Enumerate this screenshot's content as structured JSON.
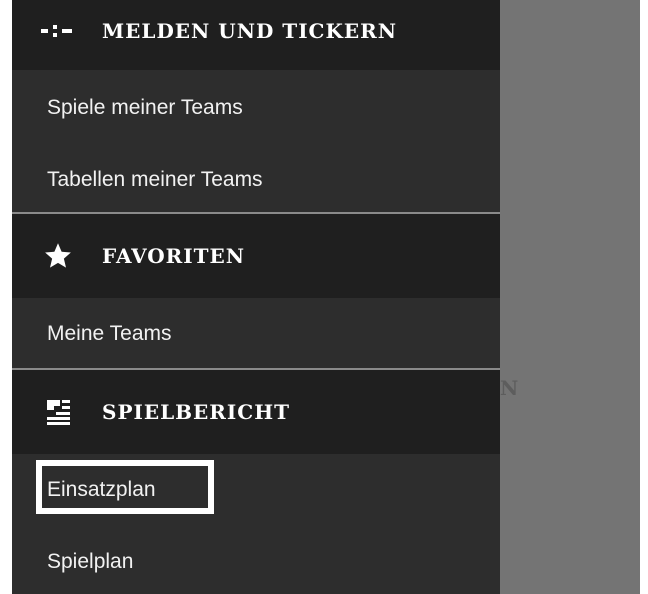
{
  "sections": {
    "melden": {
      "title": "MELDEN UND TICKERN",
      "icon": "ticker-icon",
      "items": [
        {
          "label": "Spiele meiner Teams"
        },
        {
          "label": "Tabellen meiner Teams"
        }
      ]
    },
    "favoriten": {
      "title": "FAVORITEN",
      "icon": "star-icon",
      "items": [
        {
          "label": "Meine Teams"
        }
      ]
    },
    "spielbericht": {
      "title": "SPIELBERICHT",
      "icon": "report-icon",
      "items": [
        {
          "label": "Einsatzplan"
        },
        {
          "label": "Spielplan"
        }
      ]
    }
  },
  "background": {
    "partial_text": "N"
  },
  "colors": {
    "drawer_bg": "#2d2d2d",
    "header_bg": "#1f1f1f",
    "overlay_bg": "#747474",
    "highlight": "#ffffff"
  }
}
